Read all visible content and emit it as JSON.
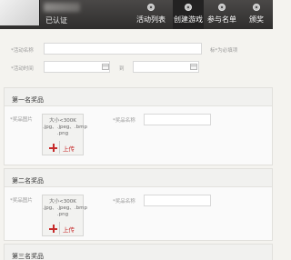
{
  "header": {
    "username": "已认证",
    "nav": [
      {
        "label": "活动列表",
        "active": false
      },
      {
        "label": "创建游戏",
        "active": true
      },
      {
        "label": "参与名单",
        "active": false
      },
      {
        "label": "颁奖",
        "active": false
      }
    ]
  },
  "form": {
    "name_label": "*活动名称",
    "name_hint": "标*为必填项",
    "time_label": "*活动时间",
    "to_label": "到"
  },
  "prizes": [
    {
      "title": "第一名奖品",
      "image_label": "*奖品图片",
      "upload_hint": "大小<300K\n.jpg、.jpeg、.bmp\n.png",
      "upload_button": "上传",
      "name_label": "*奖品名称"
    },
    {
      "title": "第二名奖品",
      "image_label": "*奖品图片",
      "upload_hint": "大小<300K\n.jpg、.jpeg、.bmp\n.png",
      "upload_button": "上传",
      "name_label": "*奖品名称"
    },
    {
      "title": "第三名奖品"
    }
  ],
  "colors": {
    "header": "#2f2e2d",
    "accent": "#c62a2a",
    "required": "#e05a2a"
  }
}
